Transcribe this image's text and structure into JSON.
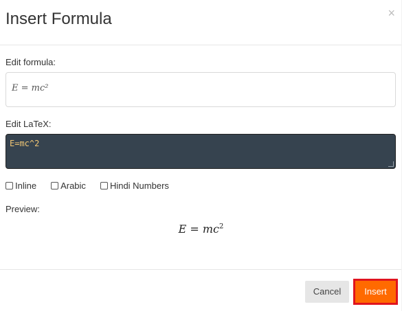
{
  "dialog": {
    "title": "Insert Formula",
    "close_label": "×"
  },
  "edit_formula": {
    "label": "Edit formula:",
    "value": "E = mc²"
  },
  "edit_latex": {
    "label": "Edit LaTeX:",
    "value": "E=mc^2"
  },
  "options": [
    {
      "label": "Inline",
      "checked": false
    },
    {
      "label": "Arabic",
      "checked": false
    },
    {
      "label": "Hindi Numbers",
      "checked": false
    }
  ],
  "preview": {
    "label": "Preview:",
    "base": "E = mc",
    "exponent": "2"
  },
  "buttons": {
    "cancel": "Cancel",
    "insert": "Insert"
  },
  "colors": {
    "accent": "#ff6a00",
    "highlight_border": "#e0141e",
    "latex_bg": "#36434f",
    "latex_text": "#f0c674"
  }
}
